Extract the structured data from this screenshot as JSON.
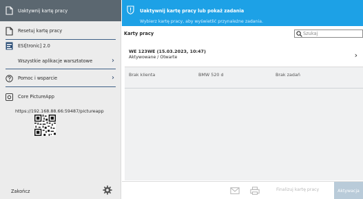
{
  "sidebar": {
    "activate_card": "Uaktywnij kartę pracy",
    "reset_card": "Resetuj kartę pracy",
    "esitronic": "ESI[tronic] 2.0",
    "all_apps": "Wszystkie aplikacje warsztatowe",
    "help": "Pomoc i wsparcie",
    "core_app": "Core PictureApp",
    "core_url": "https://192.168.88.66:59487/pictureapp",
    "finish": "Zakończ",
    "chevron": "›"
  },
  "banner": {
    "title": "Uaktywnij kartę pracy lub pokaż zadania",
    "subtitle": "Wybierz kartę pracy, aby wyświetlić przynależne zadania."
  },
  "main": {
    "section_title": "Karty pracy",
    "search_placeholder": "Szukaj",
    "card": {
      "title": "WE 123WE (15.03.2023, 10:47)",
      "status": "Aktywowane / Otwarte",
      "chevron": "›"
    },
    "row": {
      "client": "Brak klienta",
      "vehicle": "BMW 520 d",
      "tasks": "Brak zadań"
    }
  },
  "footer": {
    "finalize": "Finalizuj kartę pracy",
    "activate": "Aktywacja"
  },
  "icons": {
    "activate": "document-icon",
    "reset": "document-icon",
    "esi": "esi-logo-icon",
    "help": "question-icon",
    "core": "camera-icon",
    "settings": "gear-icon",
    "mail": "envelope-icon",
    "print": "printer-icon"
  },
  "colors": {
    "banner": "#1da1e6",
    "active_item": "#5b6770",
    "accent_line": "#3d5f86",
    "primary_button_disabled": "#b9cbd9"
  }
}
